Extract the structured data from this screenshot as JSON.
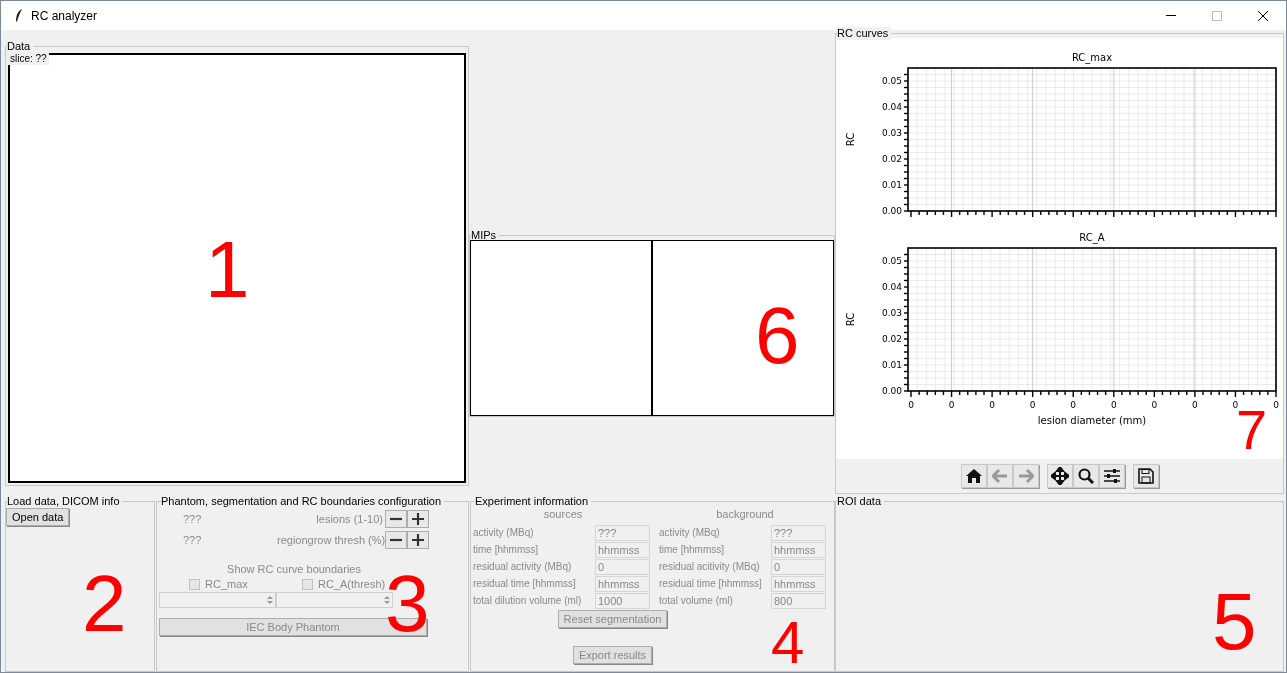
{
  "window": {
    "title": "RC analyzer"
  },
  "data_panel": {
    "title": "Data",
    "slice_label": "slice: ??",
    "annotation": "1"
  },
  "load_panel": {
    "title": "Load data, DICOM info",
    "button": "Open data",
    "annotation": "2"
  },
  "phantom_panel": {
    "title": "Phantom, segmentation and RC boundaries configuration",
    "spinners": [
      {
        "value": "???",
        "label": "lesions (1-10)"
      },
      {
        "value": "???",
        "label": "regiongrow thresh (%)"
      }
    ],
    "boundaries_title": "Show RC curve boundaries",
    "checkboxes": [
      {
        "label": "RC_max",
        "checked": false
      },
      {
        "label": "RC_A(thresh)",
        "checked": false
      }
    ],
    "button": "IEC Body Phantom",
    "annotation": "3"
  },
  "experiment_panel": {
    "title": "Experiment information",
    "columns": [
      {
        "heading": "sources",
        "fields": [
          {
            "label": "activity (MBq)",
            "value": "???"
          },
          {
            "label": "time [hhmmss]",
            "value": "hhmmss"
          },
          {
            "label": "residual activity (MBq)",
            "value": "0"
          },
          {
            "label": "residual time [hhmmss]",
            "value": "hhmmss"
          },
          {
            "label": "total dilution volume (ml)",
            "value": "1000"
          }
        ]
      },
      {
        "heading": "background",
        "fields": [
          {
            "label": "activity (MBq)",
            "value": "???"
          },
          {
            "label": "time [hhmmss]",
            "value": "hhmmss"
          },
          {
            "label": "residual acitivity (MBq)",
            "value": "0"
          },
          {
            "label": "residual time [hhmmss]",
            "value": "hhmmss"
          },
          {
            "label": "total volume (ml)",
            "value": "800"
          }
        ]
      }
    ],
    "buttons": [
      "Reset segmentation",
      "Export results"
    ],
    "annotation": "4"
  },
  "roi_panel": {
    "title": "ROI data",
    "annotation": "5"
  },
  "mips_panel": {
    "title": "MIPs",
    "annotation": "6"
  },
  "rc_panel": {
    "title": "RC curves",
    "annotation": "7",
    "charts": [
      {
        "chart_data": {
          "type": "line",
          "title": "RC_max",
          "grid": true,
          "categories": [
            null,
            null,
            null,
            null,
            null,
            null,
            null,
            null,
            null,
            null
          ],
          "ylabel": "RC",
          "ylim": [
            0,
            0.055
          ],
          "yticks": [
            {
              "value": 0,
              "label": "0.00"
            },
            {
              "value": 0.01,
              "label": "0.01"
            },
            {
              "value": 0.02,
              "label": "0.02"
            },
            {
              "value": 0.03,
              "label": "0.03"
            },
            {
              "value": 0.04,
              "label": "0.04"
            },
            {
              "value": 0.05,
              "label": "0.05"
            }
          ]
        }
      },
      {
        "chart_data": {
          "type": "line",
          "title": "RC_A",
          "grid": true,
          "categories": [
            "0",
            "0",
            "0",
            "0",
            "0",
            "0",
            "0",
            "0",
            "0",
            "0"
          ],
          "xlabel": "lesion diameter (mm)",
          "ylabel": "RC",
          "ylim": [
            0,
            0.055
          ],
          "yticks": [
            {
              "value": 0,
              "label": "0.00"
            },
            {
              "value": 0.01,
              "label": "0.01"
            },
            {
              "value": 0.02,
              "label": "0.02"
            },
            {
              "value": 0.03,
              "label": "0.03"
            },
            {
              "value": 0.04,
              "label": "0.04"
            },
            {
              "value": 0.05,
              "label": "0.05"
            }
          ]
        }
      }
    ],
    "toolbar": [
      {
        "kind": "home",
        "disabled": false
      },
      {
        "kind": "back",
        "disabled": true
      },
      {
        "kind": "forward",
        "disabled": true
      },
      {
        "kind": "pan",
        "disabled": false
      },
      {
        "kind": "zoom",
        "disabled": false
      },
      {
        "kind": "configure",
        "disabled": false
      },
      {
        "kind": "save",
        "disabled": false
      }
    ]
  }
}
